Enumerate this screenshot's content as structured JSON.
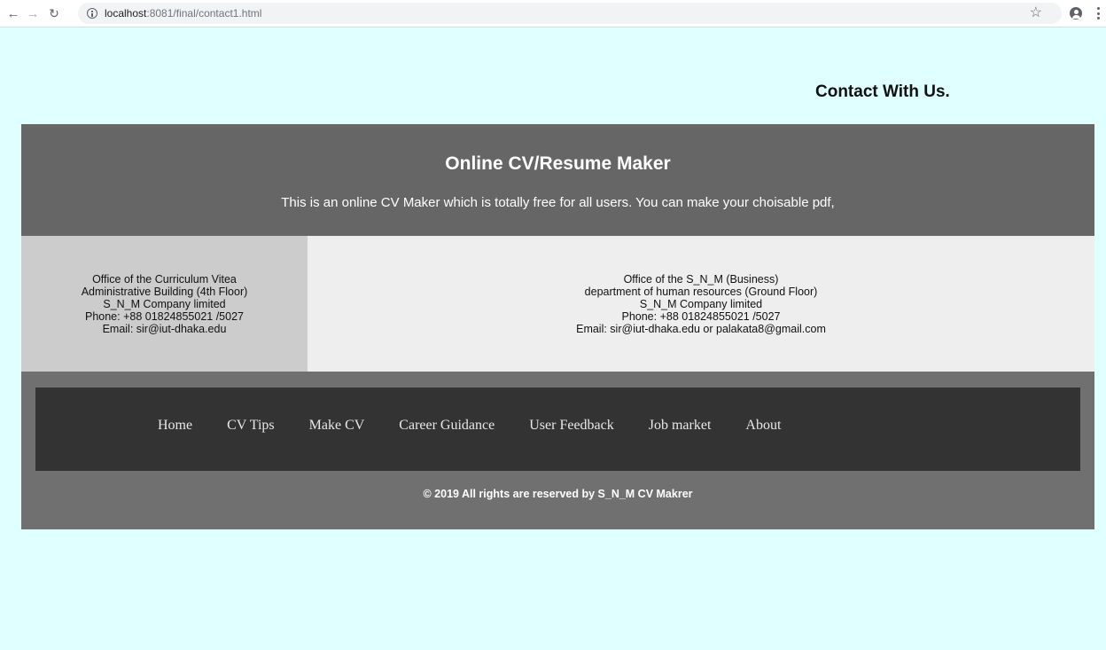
{
  "browser": {
    "url_host": "localhost",
    "url_path": ":8081/final/contact1.html"
  },
  "page": {
    "contact_heading": "Contact With Us."
  },
  "banner": {
    "title": "Online CV/Resume Maker",
    "description": "This is an online CV Maker which is totally free for all users. You can make your choisable pdf,"
  },
  "offices": {
    "left": [
      "Office of the Curriculum Vitea",
      "Administrative Building (4th Floor)",
      "S_N_M Company limited",
      "Phone: +88 01824855021 /5027",
      "Email: sir@iut-dhaka.edu"
    ],
    "right": [
      "Office of the S_N_M (Business)",
      "department of human resources (Ground Floor)",
      "S_N_M Company limited",
      "Phone: +88 01824855021 /5027",
      "Email: sir@iut-dhaka.edu or palakata8@gmail.com"
    ]
  },
  "footer": {
    "nav": [
      "Home",
      "CV Tips",
      "Make CV",
      "Career Guidance",
      "User Feedback",
      "Job market",
      "About"
    ],
    "copyright": "© 2019 All rights are reserved by S_N_M CV Makrer"
  },
  "colors": {
    "page_bg": "#e0ffff",
    "banner_bg": "#666666",
    "office_left_bg": "#cccccc",
    "office_right_bg": "#eeeeee",
    "footer_bg": "#707070",
    "navbar_bg": "#333333"
  },
  "icons": [
    "back-arrow-icon",
    "forward-arrow-icon",
    "reload-icon",
    "info-icon",
    "star-icon",
    "profile-icon",
    "menu-dots-icon"
  ]
}
